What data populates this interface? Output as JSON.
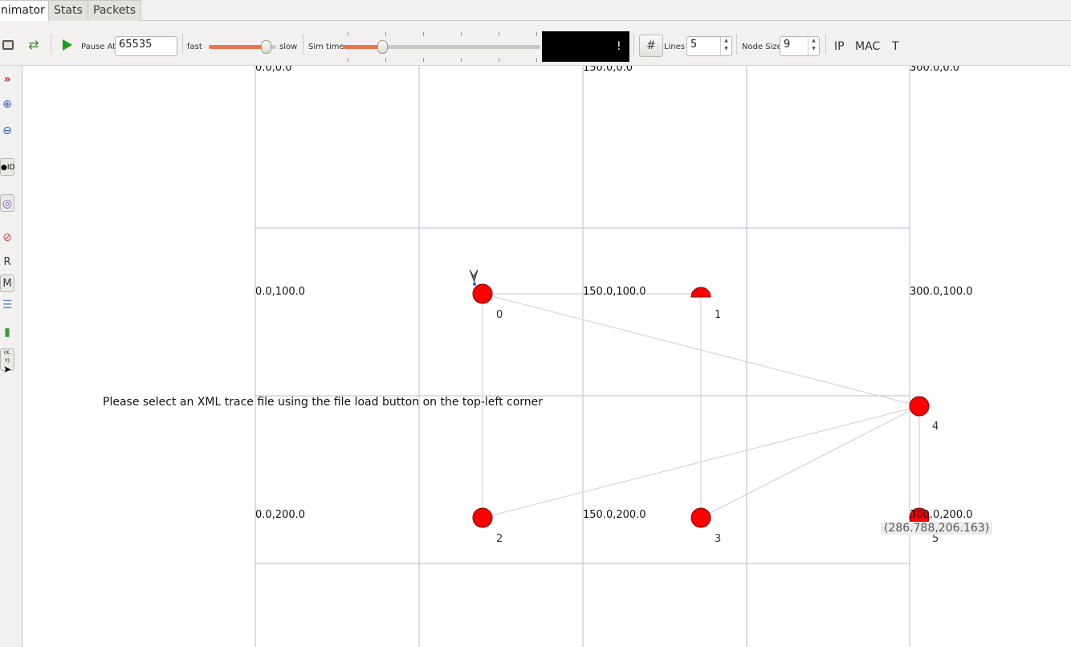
{
  "tabs": [
    {
      "label": "nimator",
      "active": true
    },
    {
      "label": "Stats",
      "active": false
    },
    {
      "label": "Packets",
      "active": false
    }
  ],
  "toolbar": {
    "pause_at_label": "Pause At",
    "pause_at_value": "65535",
    "fast_label": "fast",
    "slow_label": "slow",
    "speed_level": 0.85,
    "sim_time_label": "Sim time",
    "sim_time_level": 0.2,
    "time_display": "!",
    "grid_icon": "#",
    "lines_label": "Lines",
    "lines_value": "5",
    "node_size_label": "Node Size",
    "node_size_value": "9",
    "ip_label": "IP",
    "mac_label": "MAC",
    "t_label": "T",
    "accent_color": "#e9764e"
  },
  "sidebar": {
    "r_label": "R",
    "m_label": "M",
    "xy_label": "(X, Y)"
  },
  "canvas": {
    "grid_labels": {
      "g00": "0.0,0.0",
      "g10": "150.0,0.0",
      "g20": "300.0,0.0",
      "g01": "0.0,100.0",
      "g11": "150.0,100.0",
      "g21": "300.0,100.0",
      "g02": "0.0,200.0",
      "g12": "150.0,200.0",
      "g22": "300.0,200.0"
    },
    "nodes": [
      {
        "id": "0"
      },
      {
        "id": "1"
      },
      {
        "id": "2"
      },
      {
        "id": "3"
      },
      {
        "id": "4"
      },
      {
        "id": "5"
      }
    ],
    "message": "Please select an XML trace file using the file load button on the top-left corner",
    "mouse_coordinate": "(286.788,206.163)",
    "node_color": "#ff0000",
    "grid_color": "#b8b8d8",
    "link_color": "#d4d4dc"
  }
}
